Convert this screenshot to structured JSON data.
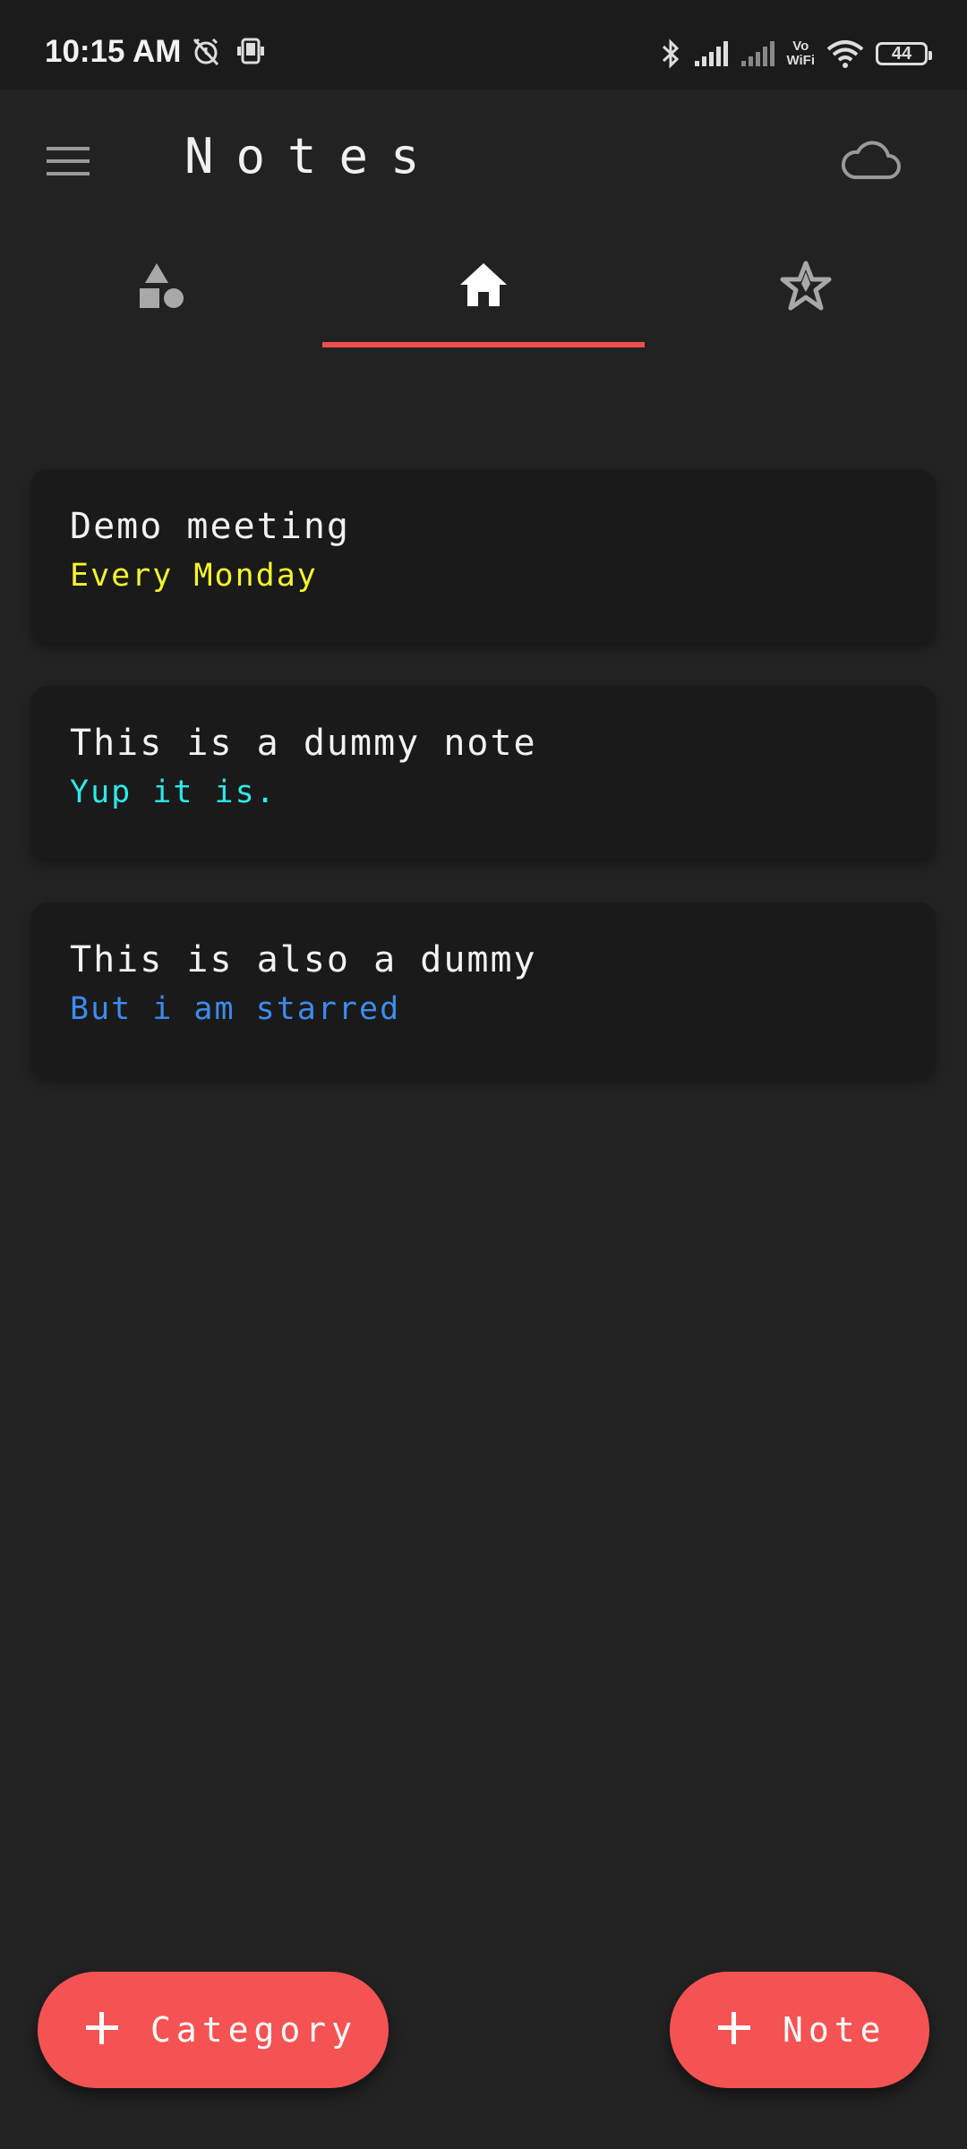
{
  "status_bar": {
    "time": "10:15 AM",
    "vowifi_line1": "Vo",
    "vowifi_line2": "WiFi",
    "battery_level": "44"
  },
  "app_bar": {
    "title": "Notes",
    "menu_icon": "hamburger-menu-icon",
    "sync_icon": "cloud-icon"
  },
  "tabs": [
    {
      "icon": "categories-shapes-icon",
      "selected": false
    },
    {
      "icon": "home-icon",
      "selected": true
    },
    {
      "icon": "star-icon",
      "selected": false
    }
  ],
  "notes": [
    {
      "title": "Demo meeting",
      "subtitle": "Every Monday",
      "color": "#f5f52e"
    },
    {
      "title": "This is a dummy note",
      "subtitle": "Yup it is.",
      "color": "#2ee8e8"
    },
    {
      "title": "This is also a dummy",
      "subtitle": "But i am starred",
      "color": "#3d8bf0"
    }
  ],
  "fabs": {
    "category_label": "Category",
    "note_label": "Note"
  },
  "colors": {
    "background": "#222222",
    "card": "#1a1a1a",
    "accent": "#f55353",
    "tab_indicator": "#ef4e4e"
  }
}
